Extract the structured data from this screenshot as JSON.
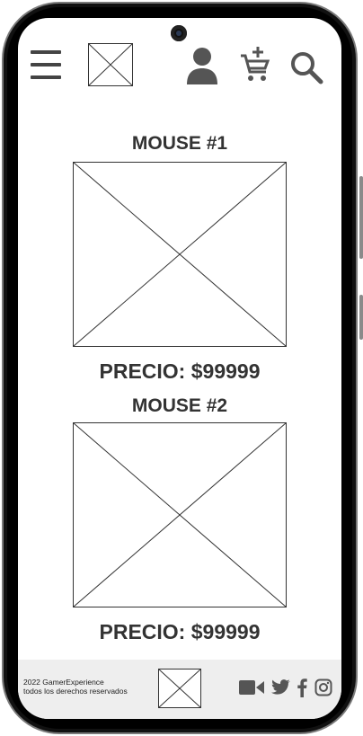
{
  "header": {
    "menu_icon": "hamburger-menu-icon",
    "logo": "placeholder-image",
    "user_icon": "user-icon",
    "cart_icon": "add-to-cart-icon",
    "search_icon": "search-icon"
  },
  "products": [
    {
      "title": "MOUSE #1",
      "price": "PRECIO: $99999"
    },
    {
      "title": "MOUSE #2",
      "price": "PRECIO: $99999"
    }
  ],
  "footer": {
    "copyright_line1": "2022 GamerExperience",
    "copyright_line2": "todos los derechos reservados",
    "social_icons": [
      "video-icon",
      "twitter-icon",
      "facebook-icon",
      "instagram-icon"
    ],
    "icon_color": "#555555",
    "background": "#eeeeee"
  }
}
